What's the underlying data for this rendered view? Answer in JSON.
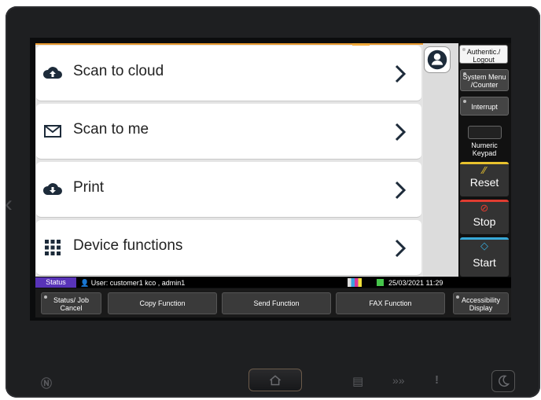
{
  "menu": [
    {
      "label": "Scan to cloud",
      "icon": "cloud-upload-icon"
    },
    {
      "label": "Scan to me",
      "icon": "envelope-icon"
    },
    {
      "label": "Print",
      "icon": "cloud-download-icon"
    },
    {
      "label": "Device functions",
      "icon": "grid-icon"
    }
  ],
  "hardkeys": {
    "auth": "Authentic./ Logout",
    "system_menu": "System Menu /Counter",
    "interrupt": "Interrupt",
    "numeric_keypad": "Numeric Keypad",
    "reset": "Reset",
    "stop": "Stop",
    "start": "Start"
  },
  "status_bar": {
    "status_label": "Status",
    "user_text": "User: customer1 kco , admin1",
    "datetime": "25/03/2021  11:29"
  },
  "function_bar": {
    "status_job_cancel": "Status/ Job Cancel",
    "copy": "Copy Function",
    "send": "Send Function",
    "fax": "FAX Function",
    "accessibility": "Accessibility Display"
  },
  "colors": {
    "accent_orange": "#e8992e",
    "reset_yellow": "#e8c22e",
    "stop_red": "#e03c31",
    "start_blue": "#37a9d8",
    "status_purple": "#5833b8"
  }
}
